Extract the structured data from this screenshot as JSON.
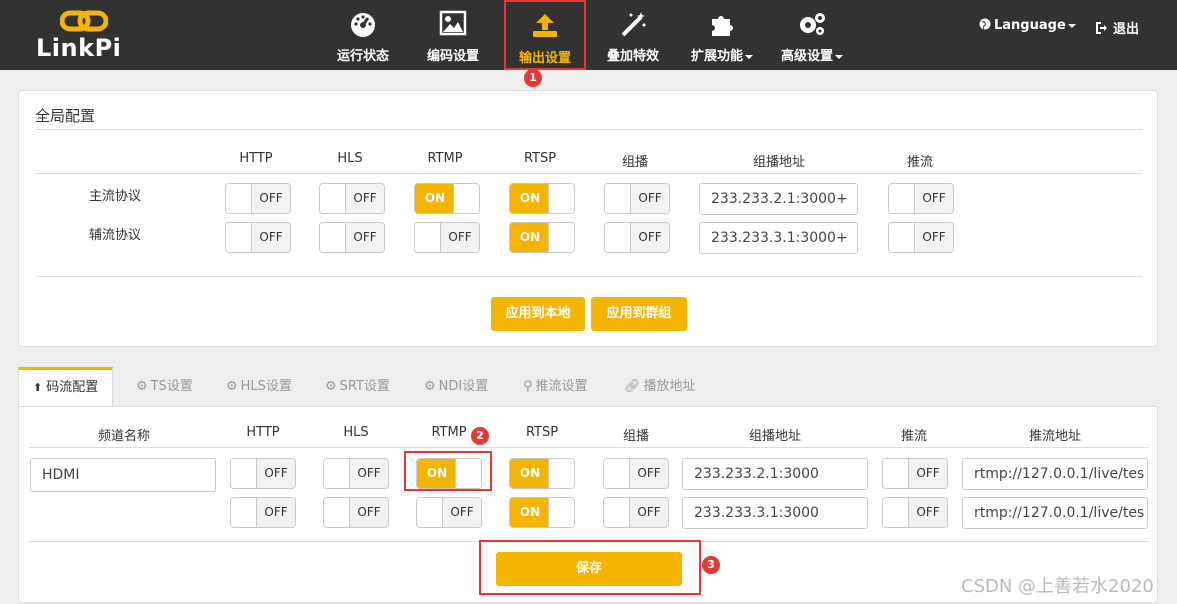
{
  "brand": {
    "name": "LinkPi",
    "color": "#f5b400"
  },
  "nav": [
    {
      "label": "运行状态",
      "icon": "gauge-icon"
    },
    {
      "label": "编码设置",
      "icon": "image-icon"
    },
    {
      "label": "输出设置",
      "icon": "upload-icon",
      "active": true
    },
    {
      "label": "叠加特效",
      "icon": "magic-wand-icon"
    },
    {
      "label": "扩展功能",
      "icon": "puzzle-icon",
      "dropdown": true
    },
    {
      "label": "高级设置",
      "icon": "gears-icon",
      "dropdown": true
    }
  ],
  "language": "Language",
  "logout": "退出",
  "badges": [
    "1",
    "2",
    "3"
  ],
  "global": {
    "title": "全局配置",
    "columns": [
      "HTTP",
      "HLS",
      "RTMP",
      "RTSP",
      "组播",
      "组播地址",
      "推流"
    ],
    "rows": [
      {
        "label": "主流协议",
        "http": "OFF",
        "hls": "OFF",
        "rtmp": "ON",
        "rtsp": "ON",
        "mcast": "OFF",
        "mcast_addr": "233.233.2.1:3000+",
        "push": "OFF"
      },
      {
        "label": "辅流协议",
        "http": "OFF",
        "hls": "OFF",
        "rtmp": "OFF",
        "rtsp": "ON",
        "mcast": "OFF",
        "mcast_addr": "233.233.3.1:3000+",
        "push": "OFF"
      }
    ],
    "apply_local": "应用到本地",
    "apply_group": "应用到群组"
  },
  "tabs": [
    "码流配置",
    "TS设置",
    "HLS设置",
    "SRT设置",
    "NDI设置",
    "推流设置",
    "播放地址"
  ],
  "stream": {
    "columns": [
      "频道名称",
      "HTTP",
      "HLS",
      "RTMP",
      "RTSP",
      "组播",
      "组播地址",
      "推流",
      "推流地址"
    ],
    "channel_name": "HDMI",
    "rows": [
      {
        "http": "OFF",
        "hls": "OFF",
        "rtmp": "ON",
        "rtsp": "ON",
        "mcast": "OFF",
        "mcast_addr": "233.233.2.1:3000",
        "push": "OFF",
        "push_addr": "rtmp://127.0.0.1/live/tes"
      },
      {
        "http": "OFF",
        "hls": "OFF",
        "rtmp": "OFF",
        "rtsp": "ON",
        "mcast": "OFF",
        "mcast_addr": "233.233.3.1:3000",
        "push": "OFF",
        "push_addr": "rtmp://127.0.0.1/live/tes"
      }
    ],
    "save": "保存"
  },
  "watermark": "CSDN @上善若水2020"
}
